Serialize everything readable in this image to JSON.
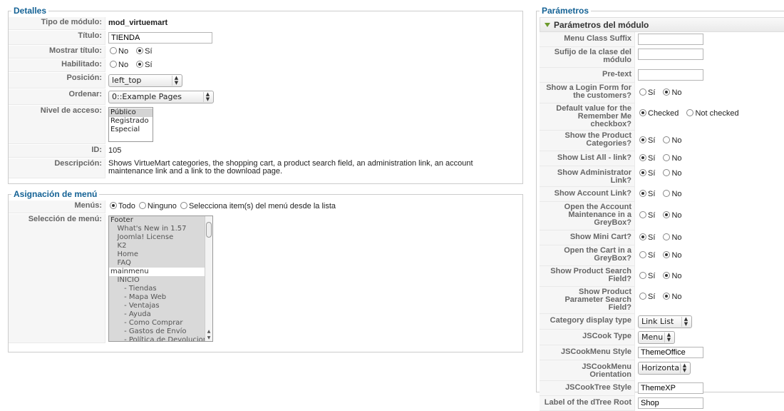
{
  "details": {
    "legend": "Detalles",
    "module_type_label": "Tipo de módulo:",
    "module_type_value": "mod_virtuemart",
    "title_label": "Título:",
    "title_value": "TIENDA",
    "show_title_label": "Mostrar título:",
    "enabled_label": "Habilitado:",
    "no_label": "No",
    "yes_label": "Sí",
    "position_label": "Posición:",
    "position_value": "left_top",
    "order_label": "Ordenar:",
    "order_value": "0::Example Pages",
    "access_label": "Nivel de acceso:",
    "access_options": [
      "Público",
      "Registrado",
      "Especial"
    ],
    "access_selected": 0,
    "id_label": "ID:",
    "id_value": "105",
    "description_label": "Descripción:",
    "description_value": "Shows VirtueMart categories, the shopping cart, a product search field, an administration link, an account maintenance link and a link to the download page."
  },
  "menu_assignment": {
    "legend": "Asignación de menú",
    "menus_label": "Menús:",
    "all_label": "Todo",
    "none_label": "Ninguno",
    "select_label": "Selecciona item(s) del menú desde la lista",
    "selection_label": "Selección de menú:",
    "items": [
      "Footer",
      "   What's New in 1.57",
      "   Joomla! License",
      "   K2",
      "   Home",
      "   FAQ",
      "mainmenu",
      "   INICIO",
      "      - Tiendas",
      "      - Mapa Web",
      "      - Ventajas",
      "      - Ayuda",
      "      - Como Comprar",
      "      - Gastos de Envío",
      "      - Política de Devoluciones"
    ]
  },
  "params": {
    "legend": "Parámetros",
    "panel_title": "Parámetros del módulo",
    "yes": "Sí",
    "no": "No",
    "menu_class_suffix": "Menu Class Suffix",
    "module_class_suffix": "Sufijo de la clase del módulo",
    "pretext": "Pre-text",
    "show_login": "Show a Login Form for the customers?",
    "remember_default": "Default value for the Remember Me checkbox?",
    "checked": "Checked",
    "not_checked": "Not checked",
    "show_categories": "Show the Product Categories?",
    "show_list_all": "Show List All - link?",
    "show_admin": "Show Administrator Link?",
    "show_account": "Show Account Link?",
    "open_account_greybox": "Open the Account Maintenance in a GreyBox?",
    "show_minicart": "Show Mini Cart?",
    "open_cart_greybox": "Open the Cart in a GreyBox?",
    "show_search": "Show Product Search Field?",
    "show_param_search": "Show Product Parameter Search Field?",
    "category_display_type": "Category display type",
    "category_display_value": "Link List",
    "jscook_type": "JSCook Type",
    "jscook_type_value": "Menu",
    "jscookmenu_style": "JSCookMenu Style",
    "jscookmenu_style_value": "ThemeOffice",
    "jscookmenu_orientation": "JSCookMenu Orientation",
    "jscookmenu_orientation_value": "Horizontal",
    "jscooktree_style": "JSCookTree Style",
    "jscooktree_style_value": "ThemeXP",
    "dtree_root_label": "Label of the dTree Root",
    "dtree_root_value": "Shop"
  }
}
